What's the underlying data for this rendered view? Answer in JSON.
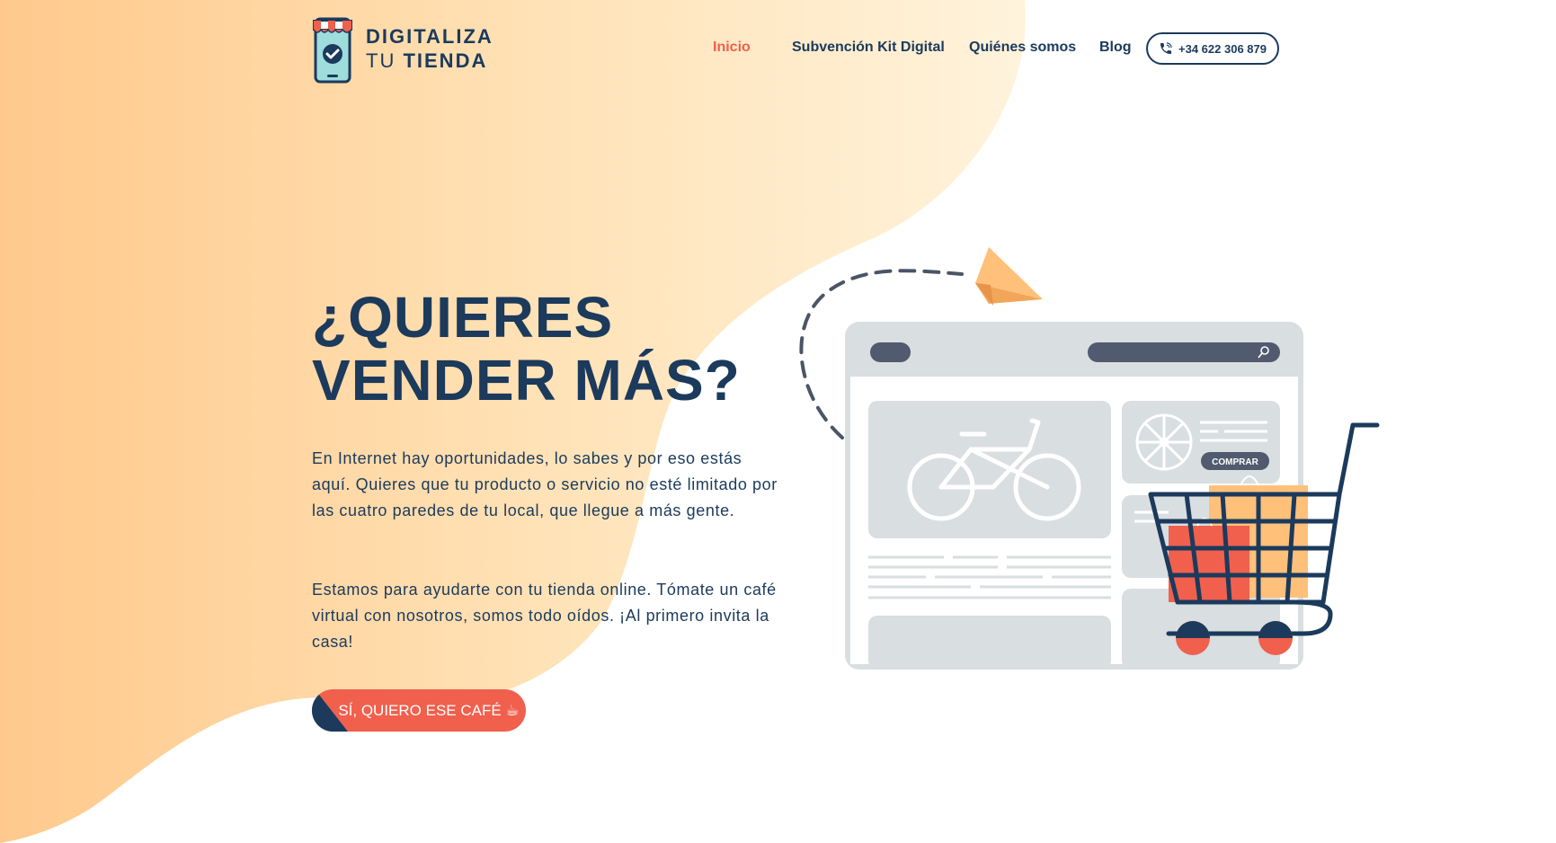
{
  "brand": {
    "line1": "DIGITALIZA",
    "line2_a": "TU",
    "line2_b": "TIENDA"
  },
  "nav": {
    "items": [
      {
        "label": "Inicio",
        "active": true
      },
      {
        "label": "Subvención Kit Digital",
        "active": false
      },
      {
        "label": "Quiénes somos",
        "active": false
      },
      {
        "label": "Blog",
        "active": false
      }
    ],
    "phone": "+34 622 306 879",
    "phone_icon": "phone-icon"
  },
  "hero": {
    "title_line1": "¿QUIERES",
    "title_line2": "VENDER MÁS?",
    "paragraph1": "En Internet hay oportunidades, lo sabes y por eso estás aquí. Quieres que tu producto o servicio no esté limitado por las cuatro paredes de tu local, que llegue a más gente.",
    "paragraph2": "Estamos para ayudarte con tu tienda online. Tómate un café virtual con nosotros, somos todo oídos. ¡Al primero invita la casa!",
    "cta": "SÍ, QUIERO ESE CAFÉ ☕"
  },
  "illustration": {
    "buy_label": "COMPRAR"
  },
  "colors": {
    "navy": "#1b3a5c",
    "accent": "#f0604d",
    "peach": "#ffc88a",
    "grey": "#d9dee0"
  }
}
